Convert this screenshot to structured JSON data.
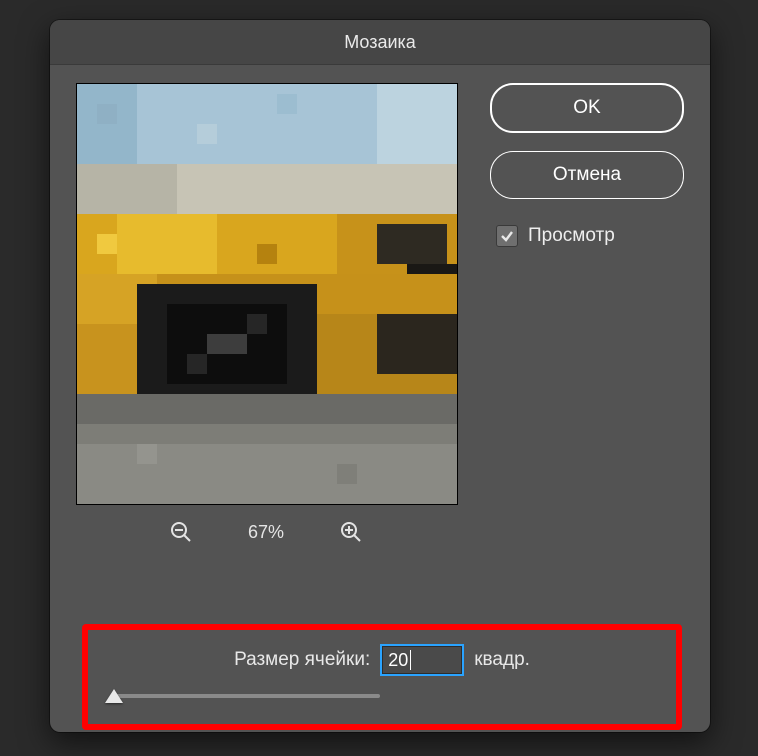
{
  "dialog": {
    "title": "Мозаика",
    "ok_label": "OK",
    "cancel_label": "Отмена",
    "preview_checkbox_label": "Просмотр",
    "preview_checked": true
  },
  "zoom": {
    "out_icon": "zoom-out",
    "in_icon": "zoom-in",
    "level": "67%"
  },
  "cell_size": {
    "label": "Размер ячейки:",
    "value": "20",
    "unit": "квадр."
  }
}
